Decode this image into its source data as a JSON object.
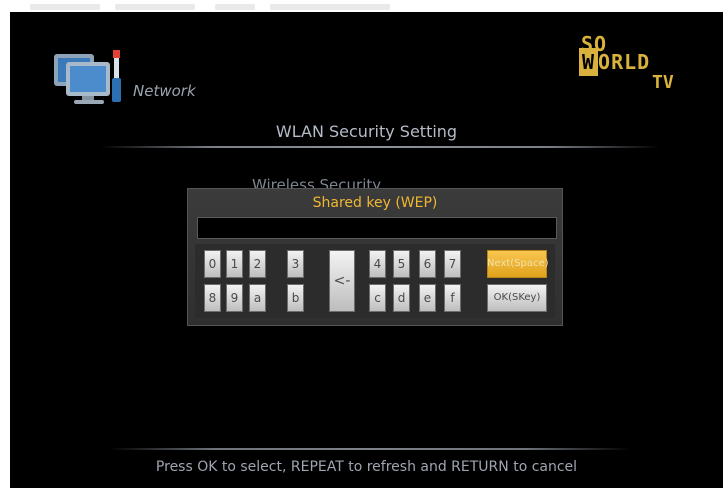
{
  "header": {
    "section_label": "Network",
    "logo_lines": [
      "SO",
      "W",
      "ORLD",
      "TV"
    ]
  },
  "page": {
    "title": "WLAN Security Setting",
    "behind_label": "Wireless Security"
  },
  "dialog": {
    "title": "Shared key (WEP)",
    "field_value": "",
    "keys_row1": [
      "0",
      "1",
      "2",
      "3",
      "4",
      "5",
      "6",
      "7"
    ],
    "keys_row2": [
      "8",
      "9",
      "a",
      "b",
      "c",
      "d",
      "e",
      "f"
    ],
    "backspace_label": "<-",
    "highlight_key_label": "Next(Space)",
    "ok_key_label": "OK(SKey)"
  },
  "footer": {
    "hint": "Press OK to select, REPEAT to refresh and RETURN to cancel"
  },
  "colors": {
    "screen_bg": "#000000",
    "accent": "#f0b830",
    "key_bg": "#e6e6e6",
    "dialog_bg": "#353535"
  },
  "icons": {
    "network": "computers-with-cable-icon"
  }
}
